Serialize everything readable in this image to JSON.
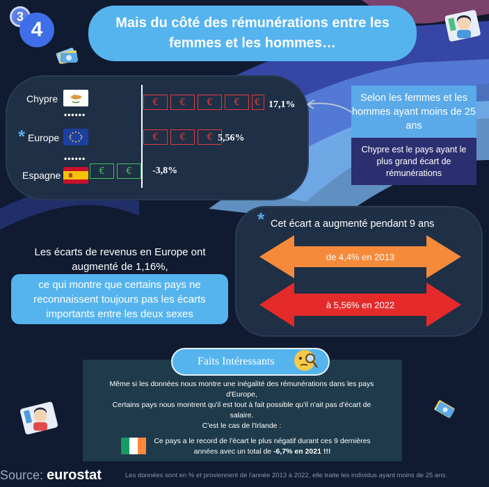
{
  "badge": {
    "step_back": "3",
    "step_front": "4"
  },
  "title": "Mais du côté des rémunérations entre les femmes et les hommes…",
  "chart_data": {
    "type": "bar",
    "categories": [
      "Chypre",
      "Europe",
      "Espagne"
    ],
    "values": [
      17.1,
      5.56,
      -3.8
    ],
    "value_labels": [
      "17,1%",
      "5,56%",
      "-3,8%"
    ],
    "bill_counts": [
      5,
      3,
      2
    ],
    "europe_marker": "*"
  },
  "side_panel": {
    "top": "Selon les femmes et les hommes ayant moins de 25 ans",
    "bottom": "Chypre est le pays ayant le plus grand écart de rémunérations"
  },
  "middle": {
    "line1": "Les écarts de revenus en Europe ont augmenté de 1,16%,",
    "highlight": "ce qui montre que certains pays ne reconnaissent toujours pas les écarts importants entre les deux sexes"
  },
  "growth": {
    "marker": "*",
    "title": "Cet écart a augmenté pendant 9 ans",
    "arrow1": "de 4,4% en 2013",
    "arrow2": "à 5,56% en 2022"
  },
  "facts": {
    "heading": "Faits Intéressants",
    "para1": "Même si les données nous montre une inégalité des rémunérations dans les pays d'Europe,",
    "para2": "Certains pays nous montrent qu'il est tout à fait possible qu'il n'ait pas d'écart de salaire.",
    "para3": "C'est le cas de l'Irlande :",
    "ireland_pre": "Ce pays a le record de l'écart le plus négatif durant ces 9 dernières années avec un total de ",
    "ireland_bold": "-6,7% en 2021 !!!"
  },
  "footer": {
    "source_label": "Source:",
    "source_name": "eurostat",
    "note": "Les données sont en % et proviennent de l'année 2013 à 2022, elle traite les individus ayant moins de 25 ans."
  },
  "colors": {
    "background": "#101a30",
    "accent_blue": "#55b4ee",
    "panel": "#1f2f45",
    "red": "#e23a3a",
    "green": "#43c25a",
    "orange": "#f58a3a",
    "arrow_red": "#e52a2a"
  }
}
